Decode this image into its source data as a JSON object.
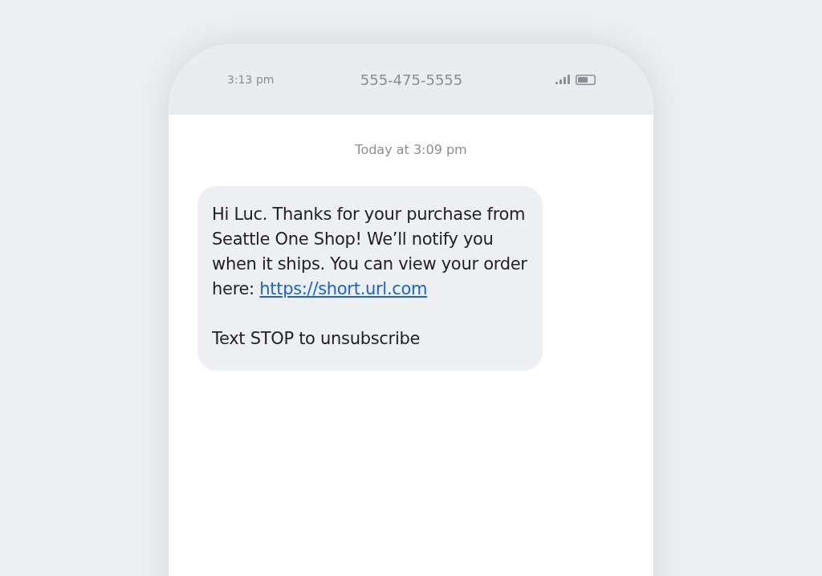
{
  "status_bar": {
    "time": "3:13 pm",
    "contact": "555-475-5555"
  },
  "thread": {
    "timestamp": "Today at 3:09 pm",
    "messages": [
      {
        "text": "Hi Luc. Thanks for your purchase from Seattle One Shop! We’ll notify you when it ships. You can view your order here:",
        "link": "https://short.url.com",
        "footer": "Text STOP to unsubscribe"
      }
    ]
  }
}
